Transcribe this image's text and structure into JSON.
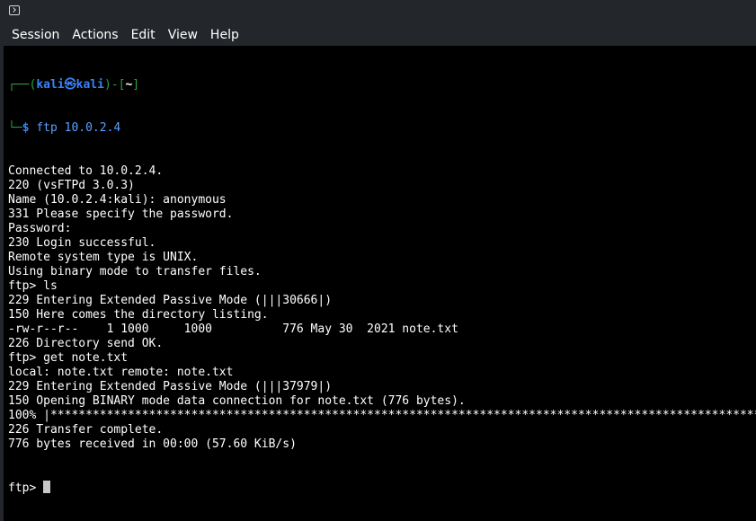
{
  "menubar": {
    "items": [
      "Session",
      "Actions",
      "Edit",
      "View",
      "Help"
    ]
  },
  "prompt": {
    "user": "kali",
    "at_symbol": "㉿",
    "host": "kali",
    "dir": "~",
    "dollar": "$",
    "command": "ftp 10.0.2.4"
  },
  "output": [
    "Connected to 10.0.2.4.",
    "220 (vsFTPd 3.0.3)",
    "Name (10.0.2.4:kali): anonymous",
    "331 Please specify the password.",
    "Password:",
    "230 Login successful.",
    "Remote system type is UNIX.",
    "Using binary mode to transfer files.",
    "ftp> ls",
    "229 Entering Extended Passive Mode (|||30666|)",
    "150 Here comes the directory listing.",
    "-rw-r--r--    1 1000     1000          776 May 30  2021 note.txt",
    "226 Directory send OK.",
    "ftp> get note.txt",
    "local: note.txt remote: note.txt",
    "229 Entering Extended Passive Mode (|||37979|)",
    "150 Opening BINARY mode data connection for note.txt (776 bytes).",
    "100% |*****************************************************************************************************",
    "226 Transfer complete.",
    "776 bytes received in 00:00 (57.60 KiB/s)"
  ],
  "current_prompt": "ftp> ",
  "colors": {
    "prompt_frame": "#2f9f3f",
    "prompt_user": "#3b82f6",
    "command": "#5aa0ff",
    "background": "#000000",
    "chrome": "#23262b"
  },
  "icons": {
    "titlebar": "terminal-icon"
  }
}
